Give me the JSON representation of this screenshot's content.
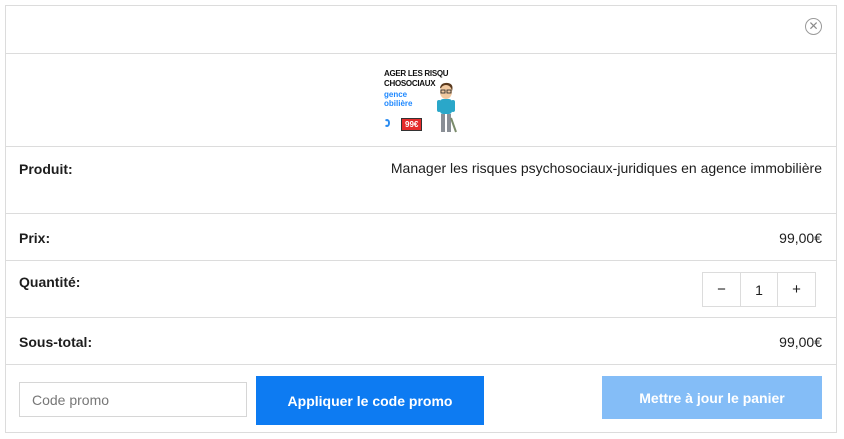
{
  "header": {
    "close_icon": "close-circle-icon"
  },
  "product": {
    "thumbnail": {
      "line1": "AGER LES RISQU",
      "line2": "CHOSOCIAUX",
      "line3": "gence",
      "line4": "obilière",
      "price_tag": "99€"
    },
    "label": "Produit:",
    "name": "Manager les risques psychosociaux-juridiques en agence immobilière"
  },
  "price": {
    "label": "Prix:",
    "value": "99,00€"
  },
  "quantity": {
    "label": "Quantité:",
    "minus": "−",
    "value": "1",
    "plus": "+"
  },
  "subtotal": {
    "label": "Sous-total:",
    "value": "99,00€"
  },
  "actions": {
    "promo_placeholder": "Code promo",
    "apply_label": "Appliquer le code promo",
    "update_label": "Mettre à jour le panier"
  },
  "colors": {
    "primary": "#0d7bf2",
    "primary_disabled": "#84bdf7",
    "border": "#dcdcdc"
  }
}
